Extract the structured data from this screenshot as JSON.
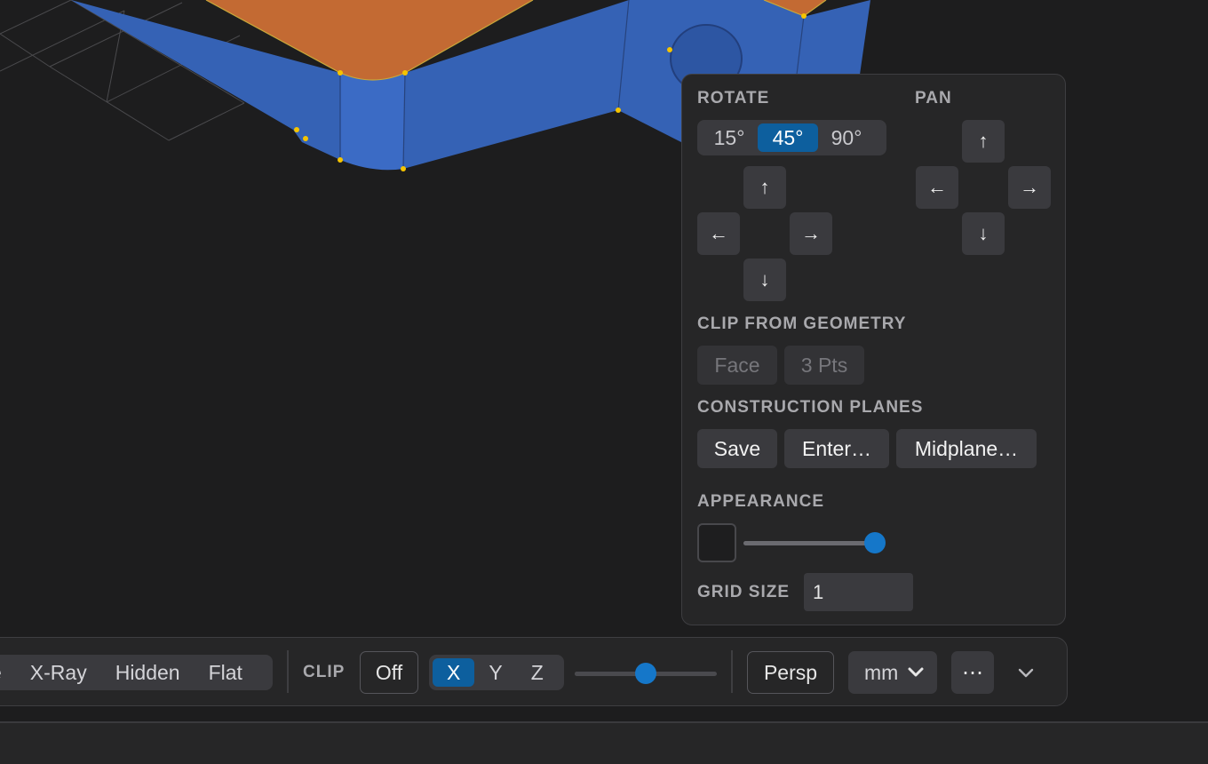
{
  "panel": {
    "rotate": {
      "label": "ROTATE",
      "angles": [
        "15°",
        "45°",
        "90°"
      ],
      "active_angle": "45°",
      "up": "↑",
      "left": "←",
      "right": "→",
      "down": "↓"
    },
    "pan": {
      "label": "PAN",
      "up": "↑",
      "left": "←",
      "right": "→",
      "down": "↓"
    },
    "clip_from_geometry": {
      "label": "CLIP FROM GEOMETRY",
      "face": "Face",
      "three_pts": "3 Pts"
    },
    "construction_planes": {
      "label": "CONSTRUCTION PLANES",
      "save": "Save",
      "enter": "Enter…",
      "midplane": "Midplane…"
    },
    "appearance": {
      "label": "APPEARANCE",
      "swatch_color": "#1e1e1f",
      "opacity_fraction": 1.0
    },
    "grid_size": {
      "label": "GRID SIZE",
      "value": "1"
    }
  },
  "toolbar": {
    "render_modes": [
      "e",
      "X-Ray",
      "Hidden",
      "Flat"
    ],
    "clip_label": "CLIP",
    "clip_off": "Off",
    "axes": [
      "X",
      "Y",
      "Z"
    ],
    "active_axis": "X",
    "clip_position_fraction": 0.5,
    "persp": "Persp",
    "unit": "mm",
    "more": "⋯",
    "collapse_icon": "chevron-down-icon"
  },
  "colors": {
    "accent": "#1577c9",
    "active_segment": "#0d5f9e",
    "model_side": "#3562b5",
    "model_top": "#c36a33",
    "vertex": "#f5c400"
  }
}
